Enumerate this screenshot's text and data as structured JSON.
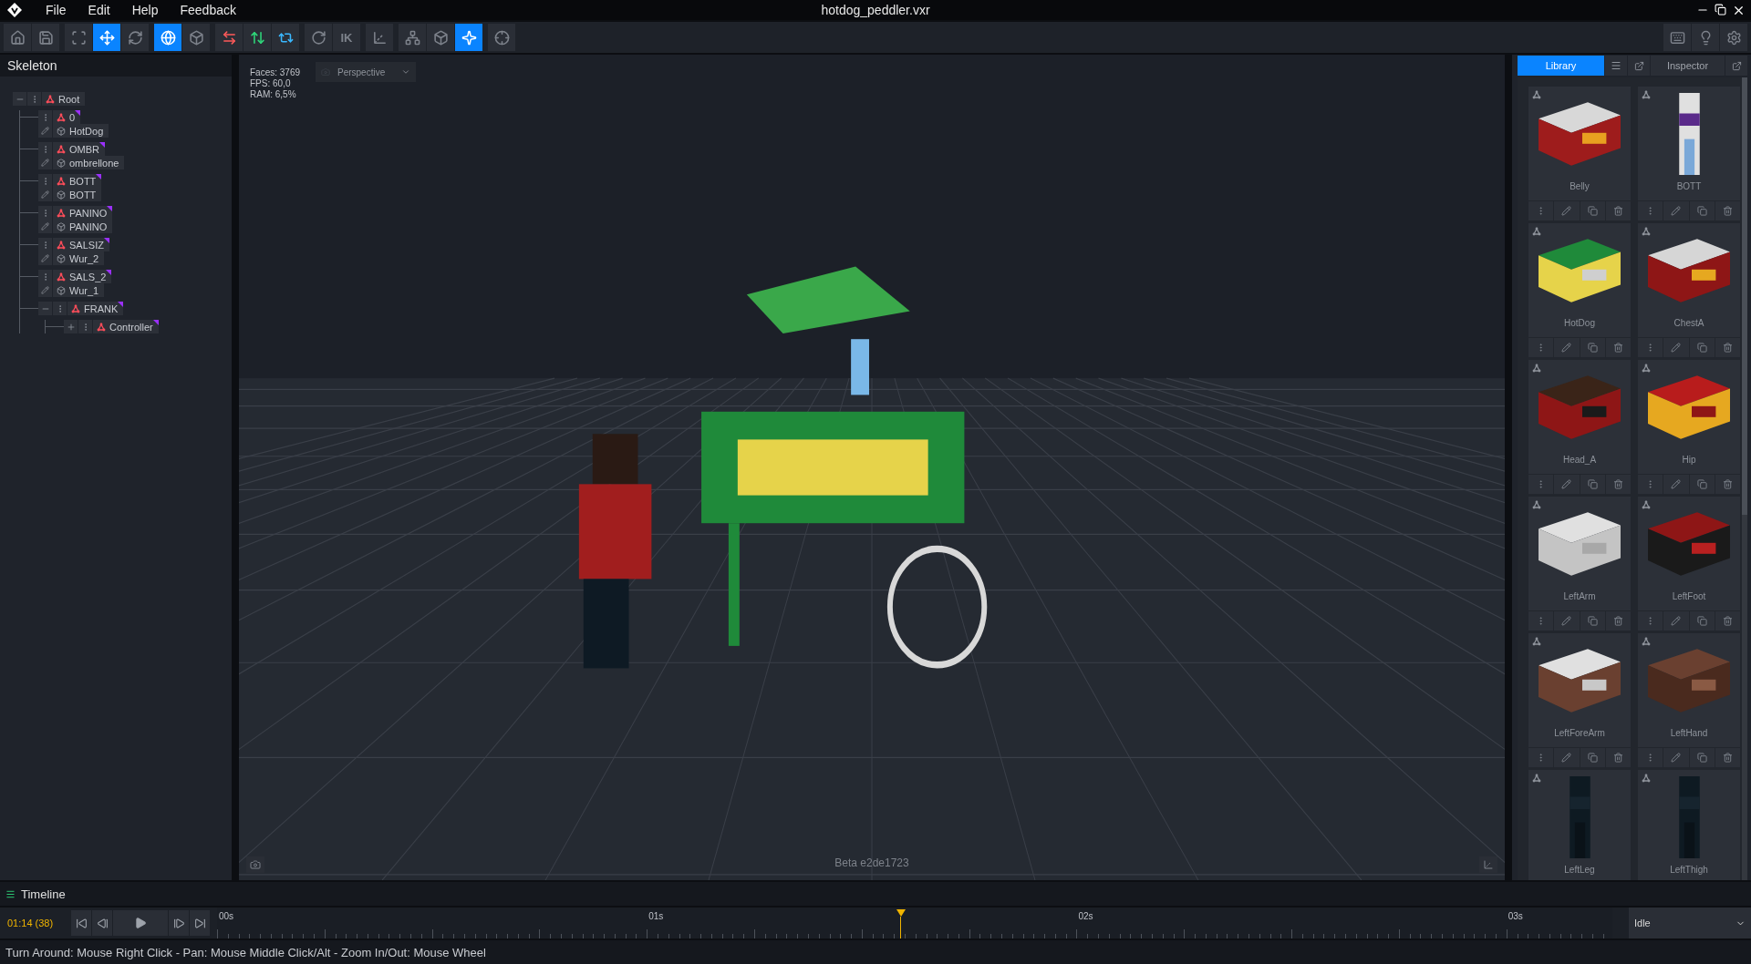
{
  "window": {
    "title": "hotdog_peddler.vxr"
  },
  "menu": [
    "File",
    "Edit",
    "Help",
    "Feedback"
  ],
  "toolbar": {
    "groups": [
      [
        {
          "kind": "home",
          "selected": false
        },
        {
          "kind": "save",
          "selected": false
        }
      ],
      [
        {
          "kind": "fit",
          "selected": false
        },
        {
          "kind": "move",
          "selected": true
        },
        {
          "kind": "rotate",
          "selected": false
        }
      ],
      [
        {
          "kind": "world",
          "selected": true
        },
        {
          "kind": "local",
          "selected": false
        }
      ],
      [
        {
          "kind": "swap",
          "selected": false
        },
        {
          "kind": "updown",
          "selected": false
        },
        {
          "kind": "diagonal",
          "selected": false
        }
      ],
      [
        {
          "kind": "gizmo",
          "selected": false
        },
        {
          "kind": "text",
          "label": "IK",
          "selected": false
        }
      ],
      [
        {
          "kind": "axes",
          "selected": false
        }
      ],
      [
        {
          "kind": "hierarchy",
          "selected": false
        },
        {
          "kind": "cube",
          "selected": false
        },
        {
          "kind": "sparkle",
          "selected": true
        }
      ],
      [
        {
          "kind": "target",
          "selected": false
        }
      ]
    ],
    "right": [
      {
        "kind": "keyboard"
      },
      {
        "kind": "bulb"
      },
      {
        "kind": "settings"
      }
    ]
  },
  "skeleton": {
    "title": "Skeleton",
    "root": {
      "name": "Root",
      "expanded": true,
      "children": [
        {
          "name": "0",
          "mesh": "HotDog"
        },
        {
          "name": "OMBR",
          "mesh": "ombrellone"
        },
        {
          "name": "BOTT",
          "mesh": "BOTT"
        },
        {
          "name": "PANINO",
          "mesh": "PANINO"
        },
        {
          "name": "SALSIZ",
          "mesh": "Wur_2"
        },
        {
          "name": "SALS_2",
          "mesh": "Wur_1"
        },
        {
          "name": "FRANK",
          "expanded": true,
          "children": [
            {
              "name": "Controller",
              "expanded": false
            }
          ]
        }
      ]
    }
  },
  "viewport": {
    "stats": [
      "Faces: 3769",
      "FPS: 60,0",
      "RAM: 6,5%"
    ],
    "camera": "Perspective",
    "version": "Beta e2de1723"
  },
  "library": {
    "tabs": [
      {
        "label": "Library",
        "selected": true
      },
      {
        "label": "Inspector",
        "selected": false
      }
    ],
    "items": [
      "Belly",
      "BOTT",
      "HotDog",
      "ChestA",
      "Head_A",
      "Hip",
      "LeftArm",
      "LeftFoot",
      "LeftForeArm",
      "LeftHand",
      "LeftLeg",
      "LeftThigh"
    ]
  },
  "timeline": {
    "title": "Timeline",
    "time": "01:14 (38)",
    "marks": [
      "00s",
      "01s",
      "02s",
      "03s"
    ],
    "animation": "Idle"
  },
  "status_bar": "Turn Around: Mouse Right Click - Pan: Mouse Middle Click/Alt - Zoom In/Out: Mouse Wheel"
}
